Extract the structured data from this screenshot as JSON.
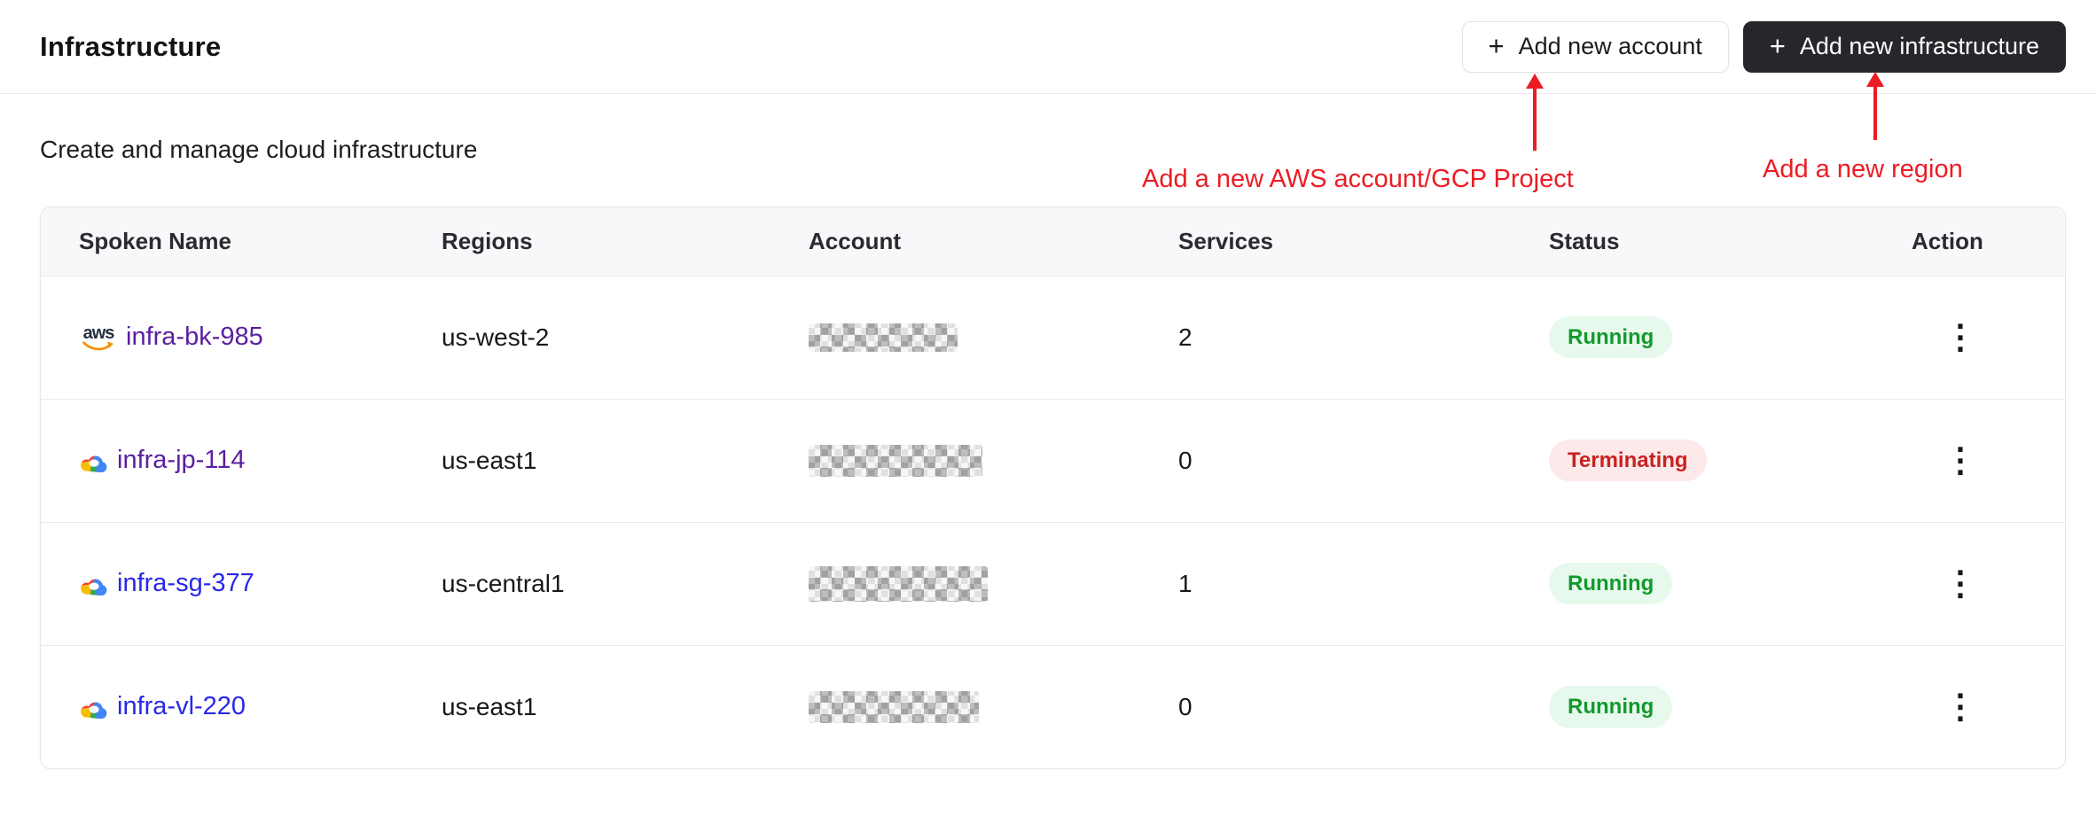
{
  "page": {
    "title": "Infrastructure",
    "subtitle": "Create and manage cloud infrastructure"
  },
  "toolbar": {
    "add_account_label": "Add new account",
    "add_infrastructure_label": "Add new infrastructure"
  },
  "icons": {
    "plus": "+",
    "kebab_vertical": "⋮",
    "aws_word": "aws",
    "aws": "aws-smile-logo",
    "gcp": "google-cloud-multicolor-logo"
  },
  "annotations": {
    "account_note": "Add a new AWS account/GCP Project",
    "region_note": "Add a new region",
    "color": "#ec1c24"
  },
  "table": {
    "columns": [
      "Spoken Name",
      "Regions",
      "Account",
      "Services",
      "Status",
      "Action"
    ],
    "rows": [
      {
        "name": "infra-bk-985",
        "provider": "aws",
        "region": "us-west-2",
        "account_redacted": true,
        "services": "2",
        "status": "Running"
      },
      {
        "name": "infra-jp-114",
        "provider": "gcp",
        "region": "us-east1",
        "account_redacted": true,
        "services": "0",
        "status": "Terminating"
      },
      {
        "name": "infra-sg-377",
        "provider": "gcp",
        "region": "us-central1",
        "account_redacted": true,
        "services": "1",
        "status": "Running"
      },
      {
        "name": "infra-vl-220",
        "provider": "gcp",
        "region": "us-east1",
        "account_redacted": true,
        "services": "0",
        "status": "Running"
      }
    ],
    "status_colors": {
      "running_bg": "#e7f9ec",
      "running_text": "#129a2d",
      "terminating_bg": "#fde9e9",
      "terminating_text": "#c92222"
    },
    "link_colors": {
      "visited": "#5a1f9e",
      "unvisited": "#2728e8"
    }
  }
}
